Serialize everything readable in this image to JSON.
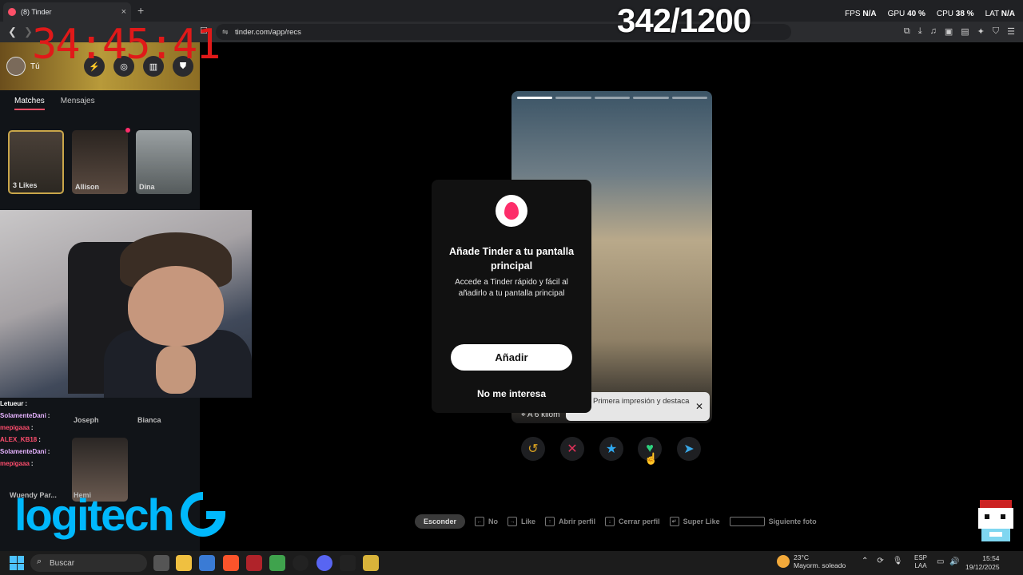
{
  "browser": {
    "tab_title": "(8) Tinder",
    "new_tab": "+",
    "close": "×",
    "url": "tinder.com/app/recs"
  },
  "overlay": {
    "counter": "342/1200",
    "timer": "34:45:41",
    "fps_label": "FPS",
    "fps_value": "N/A",
    "gpu_label": "GPU",
    "gpu_value": "40 %",
    "cpu_label": "CPU",
    "cpu_value": "38 %",
    "lat_label": "LAT",
    "lat_value": "N/A"
  },
  "sidebar": {
    "user_name": "Tú",
    "tabs": {
      "matches": "Matches",
      "messages": "Mensajes"
    },
    "matches": [
      {
        "label": "3 Likes"
      },
      {
        "label": "Allison"
      },
      {
        "label": "Dina"
      }
    ],
    "row2": {
      "joseph": "Joseph",
      "bianca": "Bianca"
    },
    "row3": {
      "wuendy": "Wuendy Par...",
      "hemi": "Hemi"
    }
  },
  "chat": [
    {
      "user": "Letueur",
      "sep": ":",
      "color": "#ffffff"
    },
    {
      "user": "SolamenteDani",
      "sep": ":",
      "color": "#e6b3ff"
    },
    {
      "user": "mepigaaa",
      "sep": ":",
      "color": "#ff4d6d"
    },
    {
      "user": "ALEX_KB18",
      "sep": ":",
      "color": "#ff4d6d"
    },
    {
      "user": "SolamenteDani",
      "sep": ":",
      "color": "#e6b3ff"
    },
    {
      "user": "mepigaaa",
      "sep": ":",
      "color": "#ff4d6d"
    }
  ],
  "brand": {
    "logitech": "logitech"
  },
  "card": {
    "distance": "A 6 kilóm",
    "tooltip": "Primera impresión y destaca"
  },
  "modal": {
    "title": "Añade Tinder a tu pantalla principal",
    "description": "Accede a Tinder rápido y fácil al añadirlo a tu pantalla principal",
    "add_button": "Añadir",
    "dismiss_button": "No me interesa"
  },
  "hints": {
    "hide": "Esconder",
    "no": "No",
    "like": "Like",
    "open_profile": "Abrir perfil",
    "close_profile": "Cerrar perfil",
    "super_like": "Super Like",
    "next_photo": "Siguiente foto"
  },
  "taskbar": {
    "search": "Buscar",
    "temperature": "23°C",
    "weather": "Mayorm. soleado",
    "lang_top": "ESP",
    "lang_bottom": "LAA",
    "time": "15:54",
    "date": "19/12/2025"
  },
  "colors": {
    "tinder_pink": "#fd5068",
    "logitech_blue": "#00b8fc",
    "timer_red": "#e01919"
  }
}
